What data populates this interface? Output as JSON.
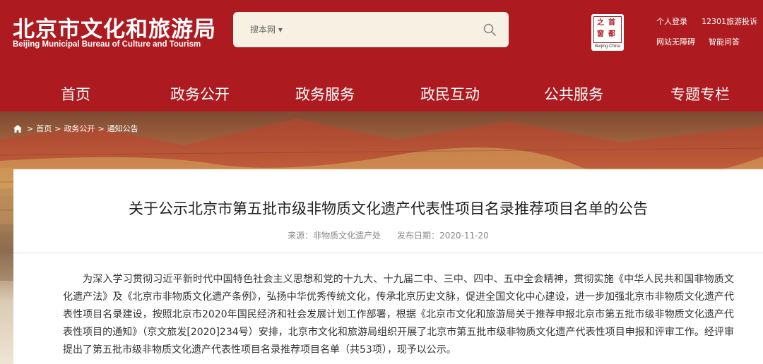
{
  "site": {
    "name_cn": "北京市文化和旅游局",
    "name_en": "Beijing Municipal Bureau of Culture and Tourism"
  },
  "search": {
    "scope": "搜本网",
    "placeholder": ""
  },
  "seal": {
    "chars": [
      "首",
      "都",
      "之",
      "窗"
    ],
    "en": "Beijing·China"
  },
  "top_links": {
    "login": "个人登录",
    "complaint": "12301旅游投诉",
    "accessibility": "网站无障碍",
    "smart_qa": "智能问答"
  },
  "nav": [
    "首页",
    "政务公开",
    "政务服务",
    "政民互动",
    "公共服务",
    "专题专栏"
  ],
  "breadcrumb": {
    "sep": ">",
    "items": [
      "首页",
      "政务公开",
      "通知公告"
    ]
  },
  "article": {
    "title": "关于公示北京市第五批市级非物质文化遗产代表性项目名录推荐项目名单的公告",
    "meta": "来源：非物质文化遗产处      发布日期：2020-11-20",
    "body": "为深入学习贯彻习近平新时代中国特色社会主义思想和党的十九大、十九届二中、三中、四中、五中全会精神，贯彻实施《中华人民共和国非物质文化遗产法》及《北京市非物质文化遗产条例》，弘扬中华优秀传统文化，传承北京历史文脉，促进全国文化中心建设，进一步加强北京市非物质文化遗产代表性项目名录建设，按照北京市2020年国民经济和社会发展计划工作部署，根据《北京市文化和旅游局关于推荐申报北京市第五批市级非物质文化遗产代表性项目的通知》（京文旅发[2020]234号）安排，北京市文化和旅游局组织开展了北京市第五批市级非物质文化遗产代表性项目申报和评审工作。经评审提出了第五批市级非物质文化遗产代表性项目名录推荐项目名单（共53项），现予以公示。"
  },
  "colors": {
    "brand_red": "#ad1b20",
    "search_bg": "#f7f0e3"
  }
}
